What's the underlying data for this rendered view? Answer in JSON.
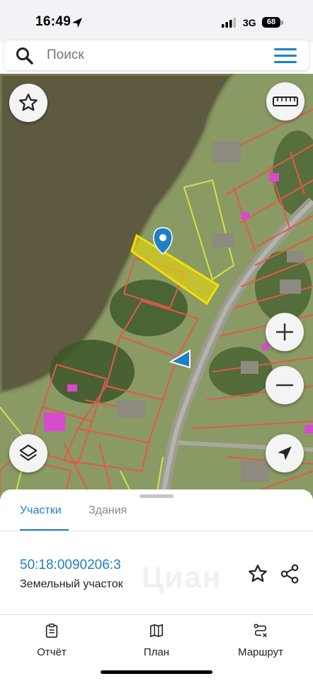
{
  "status_bar": {
    "time": "16:49",
    "network": "3G",
    "battery": "68"
  },
  "search": {
    "placeholder": "Поиск"
  },
  "map": {
    "plot_color": "#f2e100",
    "parcel_border_color": "#e05a4a",
    "building_color": "#d94ad0"
  },
  "sheet": {
    "tabs": [
      {
        "label": "Участки",
        "active": true
      },
      {
        "label": "Здания",
        "active": false
      }
    ],
    "parcel": {
      "cadastral_number": "50:18:0090206:3",
      "type": "Земельный участок"
    },
    "watermark": "Циан"
  },
  "bottom_nav": [
    {
      "label": "Отчёт",
      "icon": "report-icon"
    },
    {
      "label": "План",
      "icon": "map-plan-icon"
    },
    {
      "label": "Маршрут",
      "icon": "route-icon"
    }
  ],
  "colors": {
    "accent": "#1e7fc6"
  }
}
